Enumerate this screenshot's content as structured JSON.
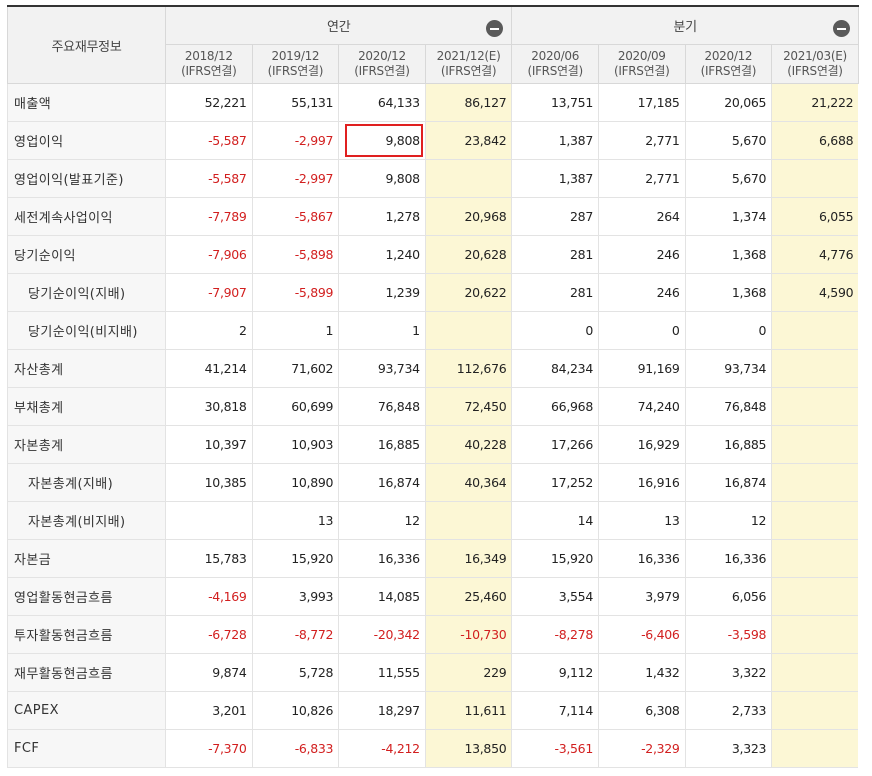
{
  "header": {
    "row_label": "주요재무정보",
    "group_annual": "연간",
    "group_quarter": "분기",
    "basis": "(IFRS연결)",
    "periods": [
      "2018/12",
      "2019/12",
      "2020/12",
      "2021/12(E)",
      "2020/06",
      "2020/09",
      "2020/12",
      "2021/03(E)"
    ],
    "estimate_columns": [
      3,
      7
    ],
    "collapse_icon": "minus-circle-icon"
  },
  "highlight": {
    "row": 1,
    "col": 2,
    "color": "#e02020"
  },
  "colors": {
    "negative": "#d21f1f",
    "estimate_bg": "#fcf7d5",
    "label_bg": "#f7f7f7",
    "header_bg": "#f2f2f2"
  },
  "rows": [
    {
      "label": "매출액",
      "sub": false,
      "values": [
        "52,221",
        "55,131",
        "64,133",
        "86,127",
        "13,751",
        "17,185",
        "20,065",
        "21,222"
      ]
    },
    {
      "label": "영업이익",
      "sub": false,
      "values": [
        "-5,587",
        "-2,997",
        "9,808",
        "23,842",
        "1,387",
        "2,771",
        "5,670",
        "6,688"
      ]
    },
    {
      "label": "영업이익(발표기준)",
      "sub": false,
      "values": [
        "-5,587",
        "-2,997",
        "9,808",
        "",
        "1,387",
        "2,771",
        "5,670",
        ""
      ]
    },
    {
      "label": "세전계속사업이익",
      "sub": false,
      "values": [
        "-7,789",
        "-5,867",
        "1,278",
        "20,968",
        "287",
        "264",
        "1,374",
        "6,055"
      ]
    },
    {
      "label": "당기순이익",
      "sub": false,
      "values": [
        "-7,906",
        "-5,898",
        "1,240",
        "20,628",
        "281",
        "246",
        "1,368",
        "4,776"
      ]
    },
    {
      "label": "당기순이익(지배)",
      "sub": true,
      "values": [
        "-7,907",
        "-5,899",
        "1,239",
        "20,622",
        "281",
        "246",
        "1,368",
        "4,590"
      ]
    },
    {
      "label": "당기순이익(비지배)",
      "sub": true,
      "values": [
        "2",
        "1",
        "1",
        "",
        "0",
        "0",
        "0",
        ""
      ]
    },
    {
      "label": "자산총계",
      "sub": false,
      "values": [
        "41,214",
        "71,602",
        "93,734",
        "112,676",
        "84,234",
        "91,169",
        "93,734",
        ""
      ]
    },
    {
      "label": "부채총계",
      "sub": false,
      "values": [
        "30,818",
        "60,699",
        "76,848",
        "72,450",
        "66,968",
        "74,240",
        "76,848",
        ""
      ]
    },
    {
      "label": "자본총계",
      "sub": false,
      "values": [
        "10,397",
        "10,903",
        "16,885",
        "40,228",
        "17,266",
        "16,929",
        "16,885",
        ""
      ]
    },
    {
      "label": "자본총계(지배)",
      "sub": true,
      "values": [
        "10,385",
        "10,890",
        "16,874",
        "40,364",
        "17,252",
        "16,916",
        "16,874",
        ""
      ]
    },
    {
      "label": "자본총계(비지배)",
      "sub": true,
      "values": [
        "",
        "13",
        "12",
        "",
        "14",
        "13",
        "12",
        ""
      ]
    },
    {
      "label": "자본금",
      "sub": false,
      "values": [
        "15,783",
        "15,920",
        "16,336",
        "16,349",
        "15,920",
        "16,336",
        "16,336",
        ""
      ]
    },
    {
      "label": "영업활동현금흐름",
      "sub": false,
      "values": [
        "-4,169",
        "3,993",
        "14,085",
        "25,460",
        "3,554",
        "3,979",
        "6,056",
        ""
      ]
    },
    {
      "label": "투자활동현금흐름",
      "sub": false,
      "values": [
        "-6,728",
        "-8,772",
        "-20,342",
        "-10,730",
        "-8,278",
        "-6,406",
        "-3,598",
        ""
      ]
    },
    {
      "label": "재무활동현금흐름",
      "sub": false,
      "values": [
        "9,874",
        "5,728",
        "11,555",
        "229",
        "9,112",
        "1,432",
        "3,322",
        ""
      ]
    },
    {
      "label": "CAPEX",
      "sub": false,
      "values": [
        "3,201",
        "10,826",
        "18,297",
        "11,611",
        "7,114",
        "6,308",
        "2,733",
        ""
      ]
    },
    {
      "label": "FCF",
      "sub": false,
      "values": [
        "-7,370",
        "-6,833",
        "-4,212",
        "13,850",
        "-3,561",
        "-2,329",
        "3,323",
        ""
      ]
    }
  ]
}
